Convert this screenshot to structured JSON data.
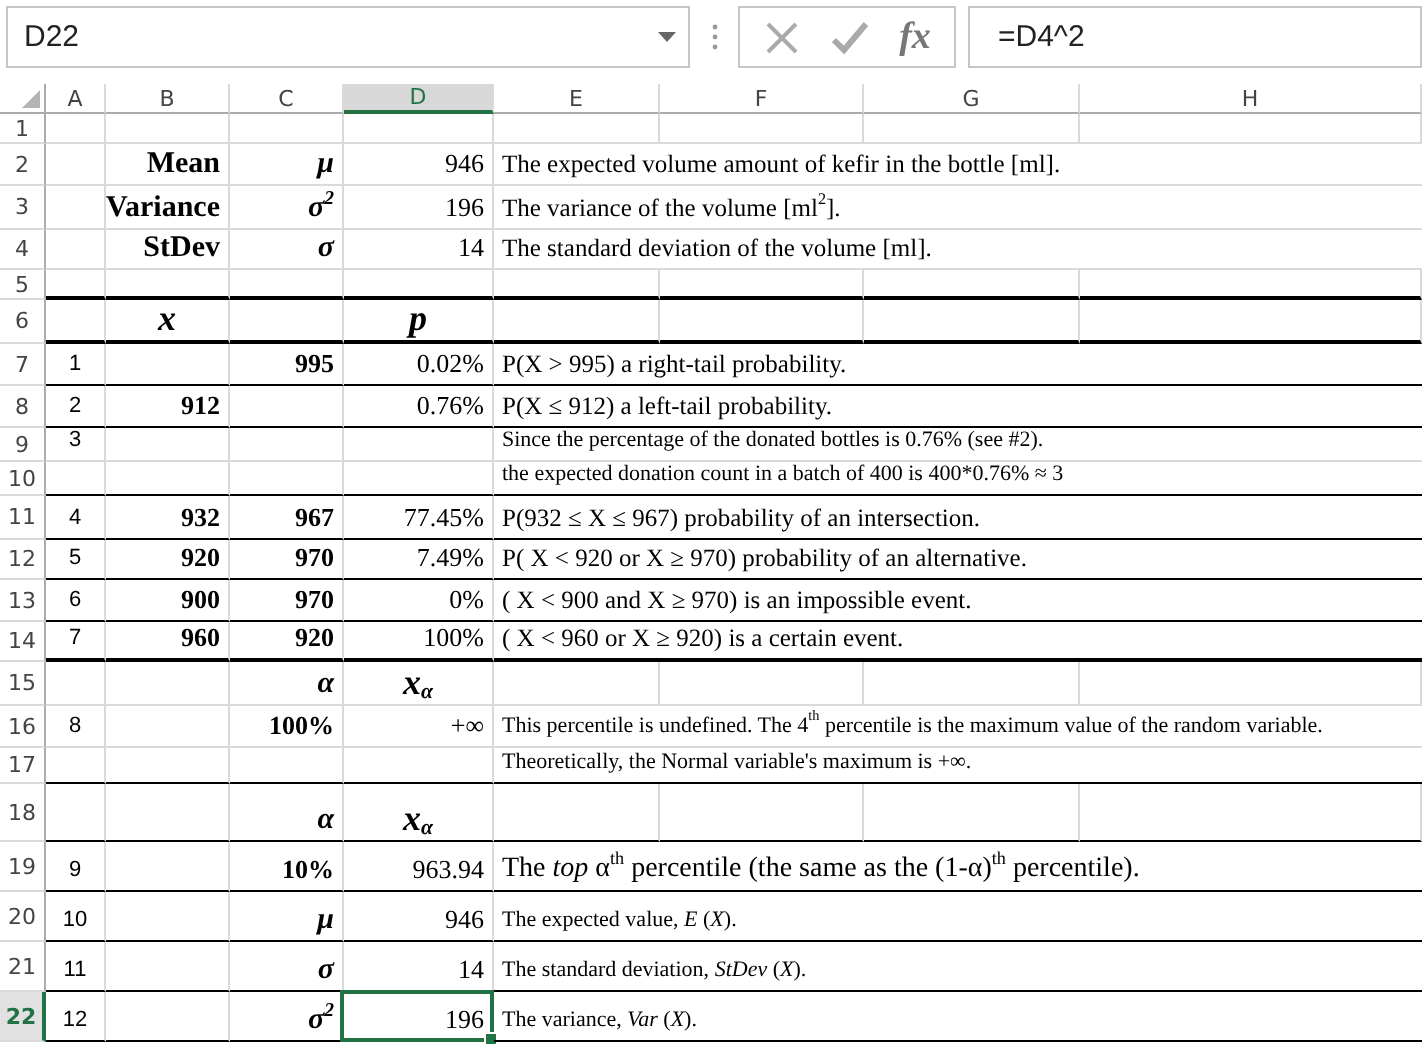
{
  "formula_bar": {
    "name_box": "D22",
    "function_label": "fx",
    "formula": "=D4^2"
  },
  "columns": [
    {
      "label": "A",
      "selected": false
    },
    {
      "label": "B",
      "selected": false
    },
    {
      "label": "C",
      "selected": false
    },
    {
      "label": "D",
      "selected": true
    },
    {
      "label": "E",
      "selected": false
    },
    {
      "label": "F",
      "selected": false
    },
    {
      "label": "G",
      "selected": false
    },
    {
      "label": "H",
      "selected": false
    }
  ],
  "rows": [
    {
      "number": "1",
      "selected": false,
      "kind": "plain",
      "cells": {}
    },
    {
      "number": "2",
      "selected": false,
      "kind": "plain",
      "cells": {
        "b": {
          "kind": "label",
          "text": "Mean"
        },
        "c": {
          "kind": "symbol",
          "text": "μ"
        },
        "d": {
          "kind": "number",
          "text": "946"
        },
        "e": {
          "kind": "text",
          "text": "The expected volume amount of kefir in the bottle [ml]."
        }
      }
    },
    {
      "number": "3",
      "selected": false,
      "kind": "plain",
      "cells": {
        "b": {
          "kind": "label",
          "text": "Variance"
        },
        "c": {
          "kind": "symbol",
          "text": "σ$^{2}$"
        },
        "d": {
          "kind": "number",
          "text": "196"
        },
        "e": {
          "kind": "text",
          "text": "The variance of the volume [ml$^{2}$]."
        }
      }
    },
    {
      "number": "4",
      "selected": false,
      "kind": "plain",
      "cells": {
        "b": {
          "kind": "label",
          "text": "StDev"
        },
        "c": {
          "kind": "symbol",
          "text": "σ"
        },
        "d": {
          "kind": "number",
          "text": "14"
        },
        "e": {
          "kind": "text",
          "text": "The standard deviation of the volume [ml]."
        }
      }
    },
    {
      "number": "5",
      "selected": false,
      "kind": "thick_ruled",
      "cells": {}
    },
    {
      "number": "6",
      "selected": false,
      "kind": "thick_ruled",
      "cells": {
        "b": {
          "kind": "heading",
          "text": "x"
        },
        "d": {
          "kind": "heading",
          "text": "p"
        }
      }
    },
    {
      "number": "7",
      "selected": false,
      "kind": "ruled",
      "cells": {
        "a": {
          "kind": "index",
          "text": "1"
        },
        "c": {
          "kind": "bold_number",
          "text": "995"
        },
        "d": {
          "kind": "number",
          "text": "0.02%"
        },
        "e": {
          "kind": "text",
          "text": "P(X > 995) a right-tail probability."
        }
      }
    },
    {
      "number": "8",
      "selected": false,
      "kind": "ruled",
      "cells": {
        "a": {
          "kind": "index",
          "text": "2"
        },
        "b": {
          "kind": "bold_number",
          "text": "912"
        },
        "d": {
          "kind": "number",
          "text": "0.76%"
        },
        "e": {
          "kind": "text",
          "text": "P(X ≤ 912) a left-tail  probability."
        }
      }
    },
    {
      "number": "9",
      "selected": false,
      "kind": "plain",
      "cells": {
        "a": {
          "kind": "index",
          "text": "3"
        },
        "e": {
          "kind": "small_text",
          "text": "Since the percentage of the donated bottles is 0.76% (see #2)."
        }
      }
    },
    {
      "number": "10",
      "selected": false,
      "kind": "ruled",
      "cells": {
        "e": {
          "kind": "small_text",
          "text": "the expected donation count in a batch of 400 is 400*0.76% ≈ 3"
        }
      }
    },
    {
      "number": "11",
      "selected": false,
      "kind": "ruled",
      "cells": {
        "a": {
          "kind": "index",
          "text": "4"
        },
        "b": {
          "kind": "bold_number",
          "text": "932"
        },
        "c": {
          "kind": "bold_number",
          "text": "967"
        },
        "d": {
          "kind": "number",
          "text": "77.45%"
        },
        "e": {
          "kind": "text",
          "text": "P(932 ≤ X ≤ 967) probability of an intersection."
        }
      }
    },
    {
      "number": "12",
      "selected": false,
      "kind": "ruled",
      "cells": {
        "a": {
          "kind": "index",
          "text": "5"
        },
        "b": {
          "kind": "bold_number",
          "text": "920"
        },
        "c": {
          "kind": "bold_number",
          "text": "970"
        },
        "d": {
          "kind": "number",
          "text": "7.49%"
        },
        "e": {
          "kind": "text",
          "text": "P( X < 920 or X ≥ 970) probability of an alternative."
        }
      }
    },
    {
      "number": "13",
      "selected": false,
      "kind": "ruled",
      "cells": {
        "a": {
          "kind": "index",
          "text": "6"
        },
        "b": {
          "kind": "bold_number",
          "text": "900"
        },
        "c": {
          "kind": "bold_number",
          "text": "970"
        },
        "d": {
          "kind": "number",
          "text": "0%"
        },
        "e": {
          "kind": "text",
          "text": "( X < 900 and X ≥ 970) is an impossible event."
        }
      }
    },
    {
      "number": "14",
      "selected": false,
      "kind": "thick_ruled",
      "cells": {
        "a": {
          "kind": "index",
          "text": "7"
        },
        "b": {
          "kind": "bold_number",
          "text": "960"
        },
        "c": {
          "kind": "bold_number",
          "text": "920"
        },
        "d": {
          "kind": "number",
          "text": "100%"
        },
        "e": {
          "kind": "text",
          "text": "( X < 960 or X ≥ 920) is a certain event."
        }
      }
    },
    {
      "number": "15",
      "selected": false,
      "kind": "plain",
      "cells": {
        "c": {
          "kind": "symbol",
          "text": "α"
        },
        "d": {
          "kind": "heading",
          "text": "x$_{α}$"
        }
      }
    },
    {
      "number": "16",
      "selected": false,
      "kind": "plain",
      "cells": {
        "a": {
          "kind": "index",
          "text": "8"
        },
        "c": {
          "kind": "bold_number",
          "text": "100%"
        },
        "d": {
          "kind": "number",
          "text": "+∞"
        },
        "e": {
          "kind": "small_text",
          "text": "This percentile is undefined. The 4$^{th}$ percentile is the maximum value of the random variable."
        }
      }
    },
    {
      "number": "17",
      "selected": false,
      "kind": "ruled",
      "cells": {
        "e": {
          "kind": "small_text",
          "text": "Theoretically, the Normal variable's maximum is +∞."
        }
      }
    },
    {
      "number": "18",
      "selected": false,
      "kind": "ruled",
      "cells": {
        "c": {
          "kind": "symbol",
          "text": "α"
        },
        "d": {
          "kind": "heading",
          "text": "x$_{α}$"
        }
      }
    },
    {
      "number": "19",
      "selected": false,
      "kind": "ruled",
      "cells": {
        "a": {
          "kind": "index",
          "text": "9"
        },
        "c": {
          "kind": "bold_number",
          "text": "10%"
        },
        "d": {
          "kind": "number",
          "text": "963.94"
        },
        "e": {
          "kind": "large_text",
          "text": "The *top* α$^{th}$ percentile (the same as the (1-α)$^{th}$ percentile)."
        }
      }
    },
    {
      "number": "20",
      "selected": false,
      "kind": "ruled",
      "cells": {
        "a": {
          "kind": "index",
          "text": "10"
        },
        "c": {
          "kind": "symbol",
          "text": "μ"
        },
        "d": {
          "kind": "number",
          "text": "946"
        },
        "e": {
          "kind": "small_text",
          "text": "The expected value, *E* (*X*)."
        }
      }
    },
    {
      "number": "21",
      "selected": false,
      "kind": "ruled",
      "cells": {
        "a": {
          "kind": "index",
          "text": "11"
        },
        "c": {
          "kind": "symbol",
          "text": "σ"
        },
        "d": {
          "kind": "number",
          "text": "14"
        },
        "e": {
          "kind": "small_text",
          "text": "The standard deviation, *StDev* (*X*)."
        }
      }
    },
    {
      "number": "22",
      "selected": true,
      "kind": "ruled",
      "cells": {
        "a": {
          "kind": "index",
          "text": "12"
        },
        "c": {
          "kind": "symbol",
          "text": "σ$^{2}$"
        },
        "d": {
          "kind": "number",
          "text": "196"
        },
        "e": {
          "kind": "small_text",
          "text": "The variance, *Var* (*X*)."
        }
      }
    }
  ]
}
